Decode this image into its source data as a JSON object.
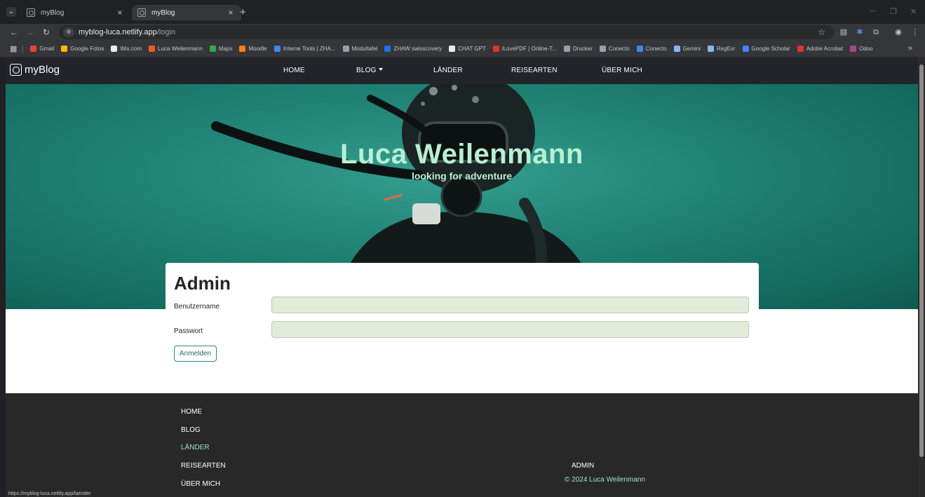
{
  "browser": {
    "tabs": [
      {
        "title": "myBlog",
        "active": false
      },
      {
        "title": "myBlog",
        "active": true
      }
    ],
    "new_tab": "+",
    "address": {
      "host": "myblog-luca.netlify.app",
      "path": "/login"
    },
    "bookmarks": [
      {
        "label": "Gmail",
        "color": "#ea4335"
      },
      {
        "label": "Google Fotos",
        "color": "#fbbc04"
      },
      {
        "label": "Wix.com",
        "color": "#e8eaed"
      },
      {
        "label": "Luca Weilenmann",
        "color": "#ff5722"
      },
      {
        "label": "Maps",
        "color": "#34a853"
      },
      {
        "label": "Moodle",
        "color": "#f98012"
      },
      {
        "label": "Interne Tools | ZHA...",
        "color": "#4285f4"
      },
      {
        "label": "Modultafel",
        "color": "#9aa0a6"
      },
      {
        "label": "ZHAW swisscovery",
        "color": "#1a73e8"
      },
      {
        "label": "CHAT GPT",
        "color": "#e8eaed"
      },
      {
        "label": "iLovePDF | Online-T...",
        "color": "#e5322d"
      },
      {
        "label": "Drucker",
        "color": "#9aa0a6"
      },
      {
        "label": "Conecto",
        "color": "#9aa0a6"
      },
      {
        "label": "Conecto",
        "color": "#4285f4"
      },
      {
        "label": "Gemini",
        "color": "#8ab4f8"
      },
      {
        "label": "RegExr",
        "color": "#8ab4f8"
      },
      {
        "label": "Google Scholar",
        "color": "#4285f4"
      },
      {
        "label": "Adobe Acrobat",
        "color": "#e5322d"
      },
      {
        "label": "Odoo",
        "color": "#a24689"
      }
    ],
    "bookmarks_more": "»",
    "status_url": "https://myblog-luca.netlify.app/laender"
  },
  "site": {
    "brand": "myBlog",
    "nav": {
      "home": "HOME",
      "blog": "BLOG",
      "laender": "LÄNDER",
      "reisearten": "REISEARTEN",
      "ueber_mich": "ÜBER MICH"
    },
    "hero": {
      "title": "Luca Weilenmann",
      "subtitle": "looking for adventure"
    },
    "login": {
      "title": "Admin",
      "username_label": "Benutzername",
      "username_value": "",
      "password_label": "Passwort",
      "password_value": "",
      "submit_label": "Anmelden"
    },
    "footer": {
      "links": [
        "HOME",
        "BLOG",
        "LÄNDER",
        "REISEARTEN",
        "ÜBER MICH"
      ],
      "active_link": "LÄNDER",
      "admin": "ADMIN",
      "copyright": "© 2024 Luca Weilenmann"
    },
    "colors": {
      "accent": "#9be6b5",
      "hero_text": "#b8f0d2",
      "navbar": "#212529",
      "footer": "#282828",
      "input_bg": "#e3ebd9"
    }
  }
}
